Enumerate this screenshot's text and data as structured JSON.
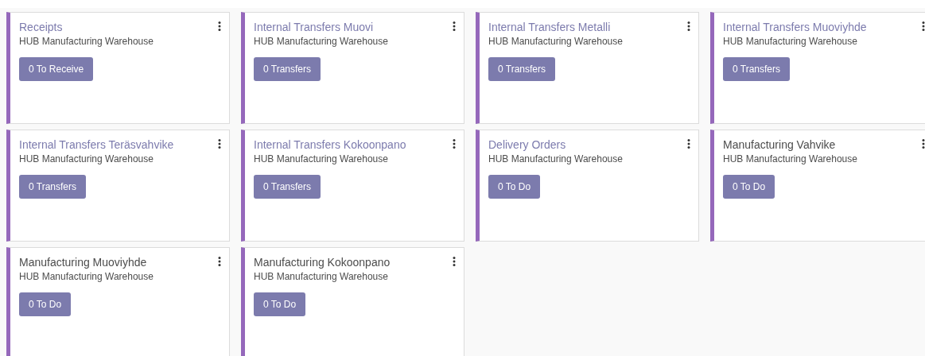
{
  "cards": [
    {
      "title": "Receipts",
      "kind": "link",
      "subtitle": "HUB Manufacturing Warehouse",
      "button": "0 To Receive"
    },
    {
      "title": "Internal Transfers Muovi",
      "kind": "link",
      "subtitle": "HUB Manufacturing Warehouse",
      "button": "0 Transfers"
    },
    {
      "title": "Internal Transfers Metalli",
      "kind": "link",
      "subtitle": "HUB Manufacturing Warehouse",
      "button": "0 Transfers"
    },
    {
      "title": "Internal Transfers Muoviyhde",
      "kind": "link",
      "subtitle": "HUB Manufacturing Warehouse",
      "button": "0 Transfers"
    },
    {
      "title": "Internal Transfers Teräsvahvike",
      "kind": "link",
      "subtitle": "HUB Manufacturing Warehouse",
      "button": "0 Transfers"
    },
    {
      "title": "Internal Transfers Kokoonpano",
      "kind": "link",
      "subtitle": "HUB Manufacturing Warehouse",
      "button": "0 Transfers"
    },
    {
      "title": "Delivery Orders",
      "kind": "link",
      "subtitle": "HUB Manufacturing Warehouse",
      "button": "0 To Do"
    },
    {
      "title": "Manufacturing Vahvike",
      "kind": "plain",
      "subtitle": "HUB Manufacturing Warehouse",
      "button": "0 To Do"
    },
    {
      "title": "Manufacturing Muoviyhde",
      "kind": "plain",
      "subtitle": "HUB Manufacturing Warehouse",
      "button": "0 To Do"
    },
    {
      "title": "Manufacturing Kokoonpano",
      "kind": "plain",
      "subtitle": "HUB Manufacturing Warehouse",
      "button": "0 To Do"
    }
  ]
}
